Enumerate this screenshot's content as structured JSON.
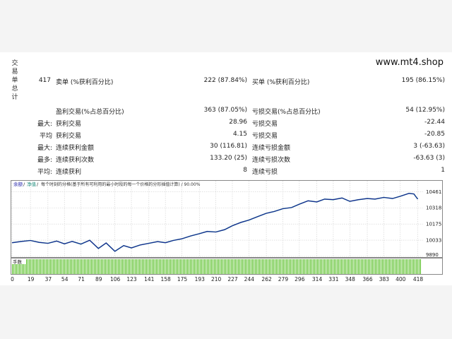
{
  "brand": "www.mt4.shop",
  "side_label": [
    "交",
    "易",
    "单",
    "总",
    "计"
  ],
  "stats": {
    "total_trades": "417",
    "short_label": "卖单 (%获利百分比)",
    "short_value": "222 (87.84%)",
    "long_label": "买单 (%获利百分比)",
    "long_value": "195 (86.15%)",
    "profit_trades_label": "盈利交易(%占总百分比)",
    "profit_trades_value": "363 (87.05%)",
    "loss_trades_label": "亏损交易(%占总百分比)",
    "loss_trades_value": "54 (12.95%)",
    "rows": [
      {
        "prefix": "最大:",
        "label1": "获利交易",
        "value1": "28.96",
        "label2": "亏损交易",
        "value2": "-22.44"
      },
      {
        "prefix": "平均",
        "label1": "获利交易",
        "value1": "4.15",
        "label2": "亏损交易",
        "value2": "-20.85"
      },
      {
        "prefix": "最大:",
        "label1": "连续获利金额",
        "value1": "30 (116.81)",
        "label2": "连续亏损金额",
        "value2": "3 (-63.63)"
      },
      {
        "prefix": "最多:",
        "label1": "连续获利次数",
        "value1": "133.20 (25)",
        "label2": "连续亏损次数",
        "value2": "-63.63 (3)"
      },
      {
        "prefix": "平均:",
        "label1": "连续获利",
        "value1": "8",
        "label2": "连续亏损",
        "value2": "1"
      }
    ]
  },
  "chart_header": {
    "balance_tab": "余额",
    "equity_tab": "净值",
    "caption": "每个时刻的分格(基于所有可利用的最小时段的每一个价格的分形插值计算) / 90.00%"
  },
  "volume_label": "手数",
  "colors": {
    "balance_line": "#1c1c8f",
    "equity_line": "#2aa5a0",
    "volume_bars": "#4cbb17",
    "grid": "#cfcfcf"
  },
  "chart_data": {
    "type": "line",
    "title": "",
    "xlabel": "",
    "ylabel": "",
    "x_ticks": [
      0,
      19,
      37,
      54,
      71,
      89,
      106,
      123,
      141,
      158,
      175,
      193,
      210,
      227,
      244,
      262,
      279,
      296,
      314,
      331,
      348,
      366,
      383,
      400,
      418
    ],
    "y_ticks": [
      9890,
      10033,
      10175,
      10318,
      10461
    ],
    "xlim": [
      0,
      422
    ],
    "ylim": [
      9890,
      10500
    ],
    "grid": true,
    "series": [
      {
        "x": [
          0,
          10,
          19,
          28,
          37,
          46,
          54,
          62,
          71,
          80,
          89,
          97,
          106,
          115,
          123,
          132,
          141,
          150,
          158,
          166,
          175,
          184,
          193,
          201,
          210,
          219,
          227,
          236,
          244,
          253,
          262,
          270,
          279,
          288,
          296,
          305,
          314,
          322,
          331,
          340,
          348,
          357,
          366,
          374,
          383,
          392,
          400,
          409,
          414,
          418
        ],
        "y": [
          10010,
          10022,
          10030,
          10013,
          10005,
          10025,
          10000,
          10022,
          9998,
          10032,
          9960,
          10008,
          9935,
          9985,
          9965,
          9990,
          10005,
          10020,
          10010,
          10030,
          10045,
          10070,
          10090,
          10110,
          10105,
          10125,
          10160,
          10190,
          10210,
          10240,
          10270,
          10285,
          10310,
          10320,
          10350,
          10380,
          10370,
          10395,
          10390,
          10405,
          10375,
          10390,
          10400,
          10395,
          10410,
          10400,
          10420,
          10445,
          10440,
          10395
        ]
      }
    ]
  }
}
